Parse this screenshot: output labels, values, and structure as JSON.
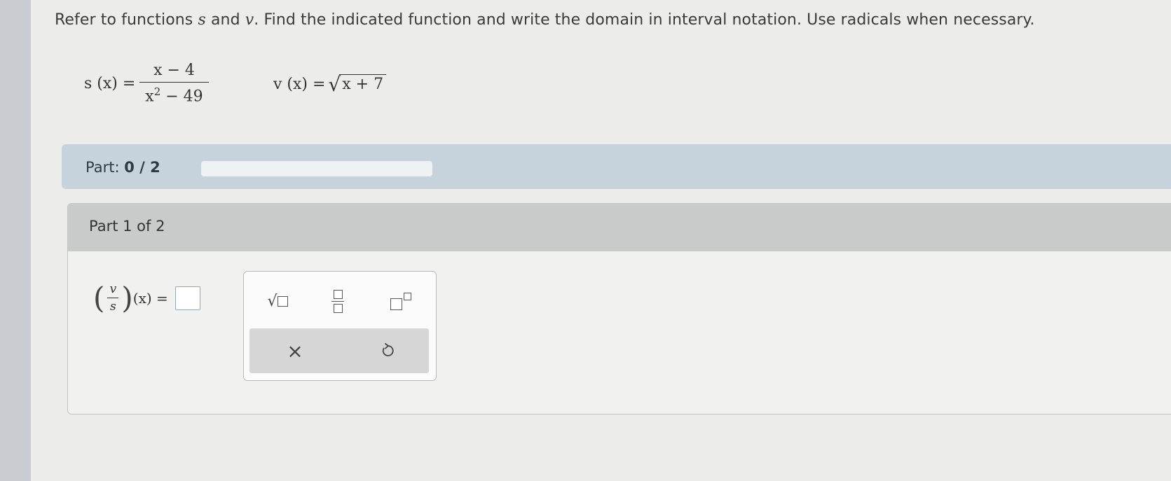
{
  "prompt": {
    "before_s": "Refer to functions ",
    "s_var": "s",
    "and": " and ",
    "v_var": "v",
    "after_v": ". Find the indicated function and write the domain in interval notation. Use radicals when necessary."
  },
  "functions": {
    "s_lhs": "s (x) =",
    "s_num": "x − 4",
    "s_den_base": "x",
    "s_den_exp": "2",
    "s_den_rest": " − 49",
    "v_lhs": "v (x) =",
    "v_radicand": "x + 7"
  },
  "progress": {
    "label": "Part:",
    "value_text": "0 / 2",
    "fraction_complete": 0
  },
  "part": {
    "title": "Part 1 of 2",
    "numerator": "v",
    "denominator": "s",
    "rhs": "(x) =",
    "answer_value": ""
  },
  "palette": {
    "sqrt_icon": "square-root-icon",
    "fraction_icon": "fraction-icon",
    "exponent_icon": "exponent-icon",
    "clear_symbol": "×",
    "undo_icon": "undo-icon"
  },
  "colors": {
    "progress_band": "#c6d3dc",
    "header": "#c9cbca",
    "answer_border": "#8fa9b8"
  }
}
